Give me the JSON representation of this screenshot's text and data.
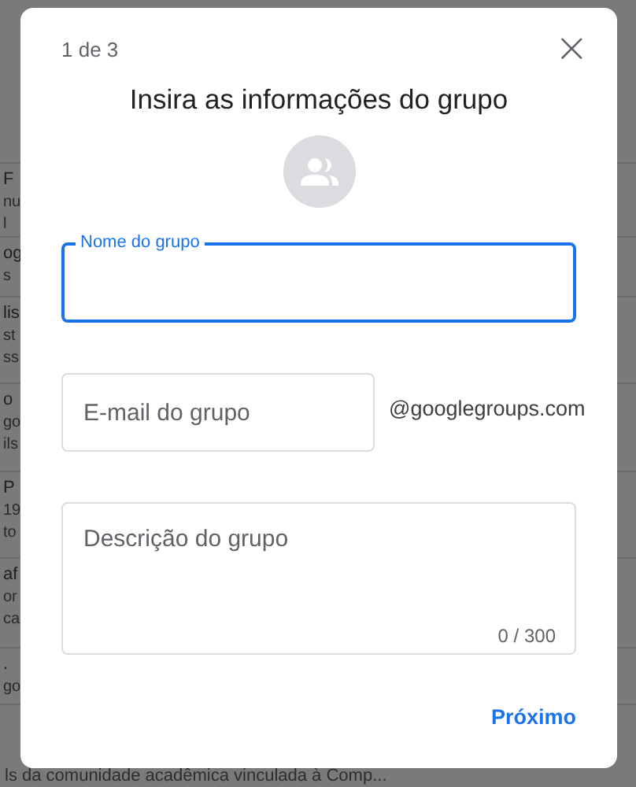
{
  "background_list": [
    {
      "lines": [
        "F",
        "nu",
        "l"
      ]
    },
    {
      "lines": [
        "og",
        "s"
      ]
    },
    {
      "lines": [
        "lis",
        "st",
        "ss"
      ]
    },
    {
      "lines": [
        "o",
        "go",
        "ils"
      ]
    },
    {
      "lines": [
        "P",
        "19",
        "to"
      ]
    },
    {
      "lines": [
        "af",
        "or",
        "ca"
      ]
    },
    {
      "lines": [
        ".",
        "go"
      ]
    }
  ],
  "background_footer": "ls da comunidade acadêmica vinculada à Comp...",
  "dialog": {
    "step": "1 de 3",
    "close": "×",
    "title": "Insira as informações do grupo",
    "name_field": {
      "label": "Nome do grupo",
      "focused": true
    },
    "email_field": {
      "placeholder": "E-mail do grupo",
      "suffix": "@googlegroups.com"
    },
    "description_field": {
      "placeholder": "Descrição do grupo",
      "counter": "0 / 300"
    },
    "next_button": "Próximo"
  }
}
